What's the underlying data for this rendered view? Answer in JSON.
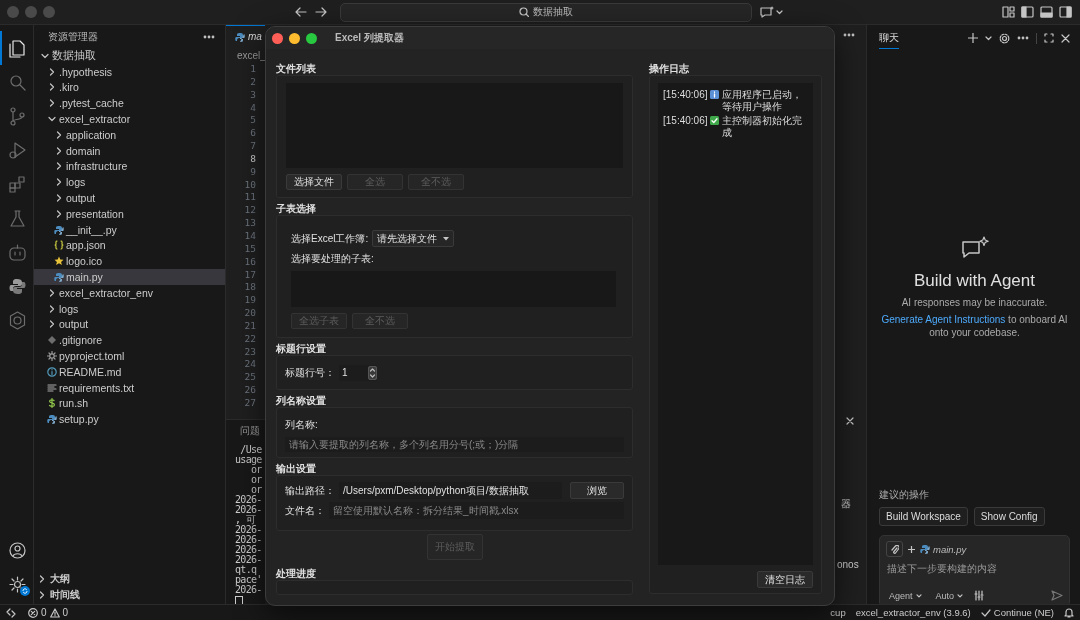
{
  "title_bar": {
    "search": "数据抽取"
  },
  "activity_bar": {
    "items": [
      {
        "selected": true
      },
      {
        "selected": false
      },
      {
        "selected": false
      },
      {
        "selected": false
      },
      {
        "selected": false
      },
      {
        "selected": false
      },
      {
        "selected": false
      },
      {
        "selected": false
      },
      {
        "selected": false
      }
    ],
    "settings_badge": true
  },
  "explorer": {
    "title": "资源管理器",
    "root": {
      "label": "数据抽取",
      "kind": "folder",
      "expanded": true,
      "selected": false,
      "children": [
        {
          "label": ".hypothesis",
          "kind": "folder",
          "expanded": false,
          "selected": false
        },
        {
          "label": ".kiro",
          "kind": "folder",
          "expanded": false,
          "selected": false
        },
        {
          "label": ".pytest_cache",
          "kind": "folder",
          "expanded": false,
          "selected": false
        },
        {
          "label": "excel_extractor",
          "kind": "folder",
          "expanded": true,
          "selected": false,
          "children": [
            {
              "label": "application",
              "kind": "folder",
              "expanded": false,
              "selected": false
            },
            {
              "label": "domain",
              "kind": "folder",
              "expanded": false,
              "selected": false
            },
            {
              "label": "infrastructure",
              "kind": "folder",
              "expanded": false,
              "selected": false
            },
            {
              "label": "logs",
              "kind": "folder",
              "expanded": false,
              "selected": false
            },
            {
              "label": "output",
              "kind": "folder",
              "expanded": false,
              "selected": false
            },
            {
              "label": "presentation",
              "kind": "folder",
              "expanded": false,
              "selected": false
            },
            {
              "label": "__init__.py",
              "kind": "python",
              "selected": false
            },
            {
              "label": "app.json",
              "kind": "json",
              "selected": false
            },
            {
              "label": "logo.ico",
              "kind": "image",
              "selected": false
            },
            {
              "label": "main.py",
              "kind": "python",
              "selected": true
            }
          ]
        },
        {
          "label": "excel_extractor_env",
          "kind": "folder",
          "expanded": false,
          "selected": false
        },
        {
          "label": "logs",
          "kind": "folder",
          "expanded": false,
          "selected": false
        },
        {
          "label": "output",
          "kind": "folder",
          "expanded": false,
          "selected": false
        },
        {
          "label": ".gitignore",
          "kind": "git",
          "selected": false
        },
        {
          "label": "pyproject.toml",
          "kind": "config",
          "selected": false
        },
        {
          "label": "README.md",
          "kind": "info",
          "selected": false
        },
        {
          "label": "requirements.txt",
          "kind": "text",
          "selected": false
        },
        {
          "label": "run.sh",
          "kind": "shell",
          "selected": false
        },
        {
          "label": "setup.py",
          "kind": "python",
          "selected": false
        }
      ]
    },
    "sections": [
      {
        "label": "大纲",
        "expanded": false
      },
      {
        "label": "时间线",
        "expanded": false
      }
    ]
  },
  "editor": {
    "tab": "ma",
    "breadcrumb": "excel_",
    "lines": [
      {
        "number": "1",
        "current": false
      },
      {
        "number": "2",
        "current": false
      },
      {
        "number": "3",
        "current": false
      },
      {
        "number": "4",
        "current": false
      },
      {
        "number": "5",
        "current": false
      },
      {
        "number": "6",
        "current": false
      },
      {
        "number": "7",
        "current": false
      },
      {
        "number": "8",
        "current": true
      },
      {
        "number": "9",
        "current": false
      },
      {
        "number": "10",
        "current": false
      },
      {
        "number": "11",
        "current": false
      },
      {
        "number": "12",
        "current": false
      },
      {
        "number": "13",
        "current": false
      },
      {
        "number": "14",
        "current": false
      },
      {
        "number": "15",
        "current": false
      },
      {
        "number": "16",
        "current": false
      },
      {
        "number": "17",
        "current": false
      },
      {
        "number": "18",
        "current": false
      },
      {
        "number": "19",
        "current": false
      },
      {
        "number": "20",
        "current": false
      },
      {
        "number": "21",
        "current": false
      },
      {
        "number": "22",
        "current": false
      },
      {
        "number": "23",
        "current": false
      },
      {
        "number": "24",
        "current": false
      },
      {
        "number": "25",
        "current": false
      },
      {
        "number": "26",
        "current": false
      },
      {
        "number": "27",
        "current": false
      }
    ],
    "panel_tab": "问题",
    "terminal": [
      " /Use",
      "usage",
      "   or",
      "   or",
      "   or",
      "2026-",
      "2026-",
      ", 可",
      "2026-",
      "2026-",
      "2026-",
      "2026-",
      "qt.q",
      "pace'",
      "2026-"
    ],
    "terminal_edge": [
      "器",
      "onos"
    ]
  },
  "dialog": {
    "title": "Excel 列提取器",
    "file_list": {
      "heading": "文件列表",
      "buttons": [
        {
          "label": "选择文件",
          "disabled": false
        },
        {
          "label": "全选",
          "disabled": true
        },
        {
          "label": "全不选",
          "disabled": true
        }
      ]
    },
    "sheets": {
      "heading": "子表选择",
      "workbook_label": "选择Excel工作簿:",
      "workbook_select": "请先选择文件",
      "sheet_label": "选择要处理的子表:",
      "buttons": [
        {
          "label": "全选子表",
          "disabled": true
        },
        {
          "label": "全不选",
          "disabled": true
        }
      ]
    },
    "header_row": {
      "heading": "标题行设置",
      "label": "标题行号：",
      "value": "1"
    },
    "columns": {
      "heading": "列名称设置",
      "label": "列名称:",
      "placeholder": "请输入要提取的列名称，多个列名用分号(;或；)分隔"
    },
    "output": {
      "heading": "输出设置",
      "path_label": "输出路径：",
      "path": "/Users/pxm/Desktop/python项目/数据抽取",
      "browse": "浏览",
      "name_label": "文件名：",
      "name_placeholder": "留空使用默认名称：拆分结果_时间戳.xlsx"
    },
    "start": {
      "label": "开始提取",
      "disabled": true
    },
    "progress": {
      "heading": "处理进度",
      "level": 0
    },
    "log": {
      "heading": "操作日志",
      "entries": [
        {
          "time": "[15:40:06]",
          "kind": "info",
          "text": "应用程序已启动，等待用户操作"
        },
        {
          "time": "[15:40:06]",
          "kind": "success",
          "text": "主控制器初始化完成"
        }
      ],
      "clear": "清空日志"
    }
  },
  "chat": {
    "tab": {
      "label": "聊天",
      "selected": true
    },
    "heading": "Build with Agent",
    "note": "AI responses may be inaccurate.",
    "onboard_link": "Generate Agent Instructions",
    "onboard_text": " to onboard AI onto your codebase.",
    "suggestions_label": "建议的操作",
    "suggestions": [
      "Build Workspace",
      "Show Config"
    ],
    "input": {
      "context_file": "main.py",
      "placeholder": "描述下一步要构建的内容",
      "mode": "Agent",
      "model": "Auto"
    }
  },
  "status_bar": {
    "errors": "0",
    "warnings": "0",
    "cut_item": "cup",
    "interpreter": "excel_extractor_env (3.9.6)",
    "continue": "Continue (NE)"
  }
}
